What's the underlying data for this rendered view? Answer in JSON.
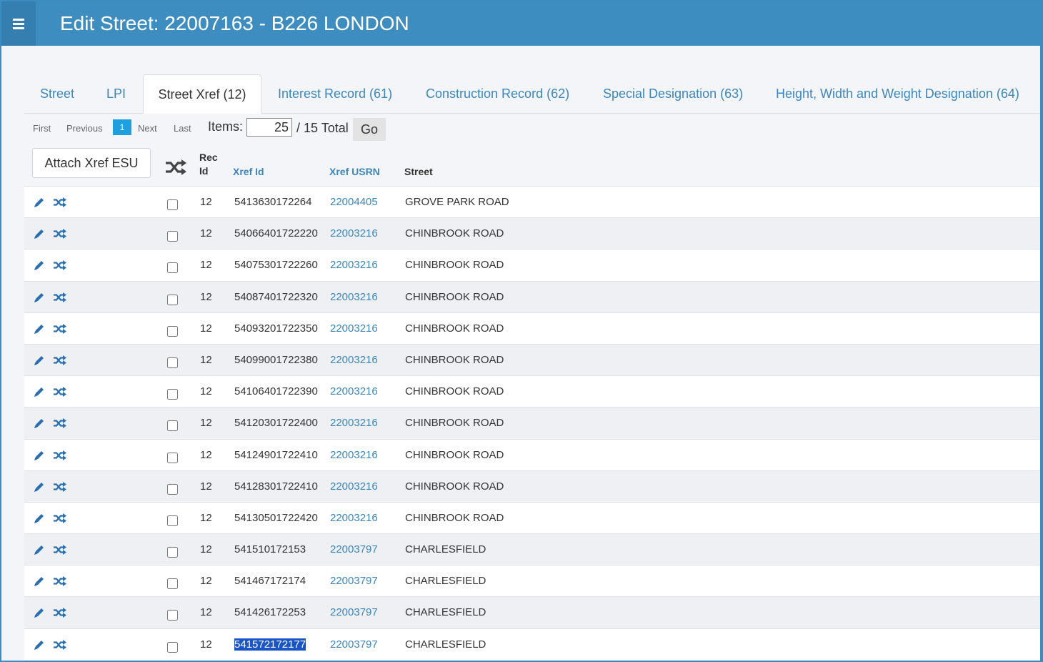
{
  "header": {
    "title": "Edit Street: 22007163 - B226 LONDON"
  },
  "tabs": [
    {
      "label": "Street",
      "active": false
    },
    {
      "label": "LPI",
      "active": false
    },
    {
      "label": "Street Xref (12)",
      "active": true
    },
    {
      "label": "Interest Record (61)",
      "active": false
    },
    {
      "label": "Construction Record (62)",
      "active": false
    },
    {
      "label": "Special Designation (63)",
      "active": false
    },
    {
      "label": "Height, Width and Weight Designation (64)",
      "active": false
    }
  ],
  "pager": {
    "first": "First",
    "previous": "Previous",
    "current": "1",
    "next": "Next",
    "last": "Last",
    "items_label": "Items:",
    "items_value": "25",
    "total_label": "/ 15 Total",
    "go_label": "Go"
  },
  "attach_button": "Attach Xref ESU",
  "columns": {
    "rec_id_line1": "Rec",
    "rec_id_line2": "Id",
    "xref_id": "Xref Id",
    "xref_usrn": "Xref USRN",
    "street": "Street"
  },
  "rows": [
    {
      "rec_id": "12",
      "xref_id": "5413630172264",
      "xref_usrn": "22004405",
      "street": "GROVE PARK ROAD"
    },
    {
      "rec_id": "12",
      "xref_id": "54066401722220",
      "xref_usrn": "22003216",
      "street": "CHINBROOK ROAD"
    },
    {
      "rec_id": "12",
      "xref_id": "54075301722260",
      "xref_usrn": "22003216",
      "street": "CHINBROOK ROAD"
    },
    {
      "rec_id": "12",
      "xref_id": "54087401722320",
      "xref_usrn": "22003216",
      "street": "CHINBROOK ROAD"
    },
    {
      "rec_id": "12",
      "xref_id": "54093201722350",
      "xref_usrn": "22003216",
      "street": "CHINBROOK ROAD"
    },
    {
      "rec_id": "12",
      "xref_id": "54099001722380",
      "xref_usrn": "22003216",
      "street": "CHINBROOK ROAD"
    },
    {
      "rec_id": "12",
      "xref_id": "54106401722390",
      "xref_usrn": "22003216",
      "street": "CHINBROOK ROAD"
    },
    {
      "rec_id": "12",
      "xref_id": "54120301722400",
      "xref_usrn": "22003216",
      "street": "CHINBROOK ROAD"
    },
    {
      "rec_id": "12",
      "xref_id": "54124901722410",
      "xref_usrn": "22003216",
      "street": "CHINBROOK ROAD"
    },
    {
      "rec_id": "12",
      "xref_id": "54128301722410",
      "xref_usrn": "22003216",
      "street": "CHINBROOK ROAD"
    },
    {
      "rec_id": "12",
      "xref_id": "54130501722420",
      "xref_usrn": "22003216",
      "street": "CHINBROOK ROAD"
    },
    {
      "rec_id": "12",
      "xref_id": "541510172153",
      "xref_usrn": "22003797",
      "street": "CHARLESFIELD"
    },
    {
      "rec_id": "12",
      "xref_id": "541467172174",
      "xref_usrn": "22003797",
      "street": "CHARLESFIELD"
    },
    {
      "rec_id": "12",
      "xref_id": "541426172253",
      "xref_usrn": "22003797",
      "street": "CHARLESFIELD"
    },
    {
      "rec_id": "12",
      "xref_id": "541572172177",
      "xref_usrn": "22003797",
      "street": "CHARLESFIELD",
      "selected": true
    }
  ],
  "colors": {
    "header_bg": "#3d8dc0",
    "link": "#3b86bd",
    "pager_current": "#1ea0e0",
    "selection": "#1a55c8"
  },
  "icons": {
    "menu": "hamburger-menu-icon",
    "edit": "pencil-icon",
    "xref": "shuffle-icon"
  }
}
